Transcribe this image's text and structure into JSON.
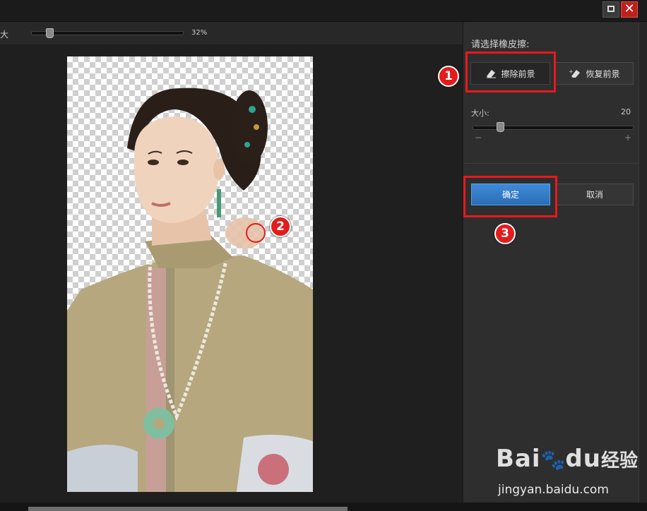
{
  "window": {
    "maximize_icon": "maximize-icon",
    "close_symbol": "✕"
  },
  "toolbar": {
    "zoom_label": "大",
    "zoom_value": "32%",
    "zoom_level": 0.1
  },
  "panel": {
    "title": "请选择橡皮擦:",
    "erase_button": "擦除前景",
    "restore_button": "恢复前景",
    "size_label": "大小:",
    "size_value": "20",
    "size_level": 0.15,
    "minus": "−",
    "plus": "+",
    "ok_button": "确定",
    "cancel_button": "取消"
  },
  "annotations": {
    "step1": "1",
    "step2": "2",
    "step3": "3",
    "highlight_color": "#e8191d"
  },
  "watermark": {
    "brand": "Bai",
    "brand_suffix": "du",
    "cn": "经验",
    "url": "jingyan.baidu.com"
  },
  "colors": {
    "ok_blue": "#2f78c8",
    "panel_bg": "#2e2e2e",
    "canvas_bg": "#1f1f1f"
  }
}
